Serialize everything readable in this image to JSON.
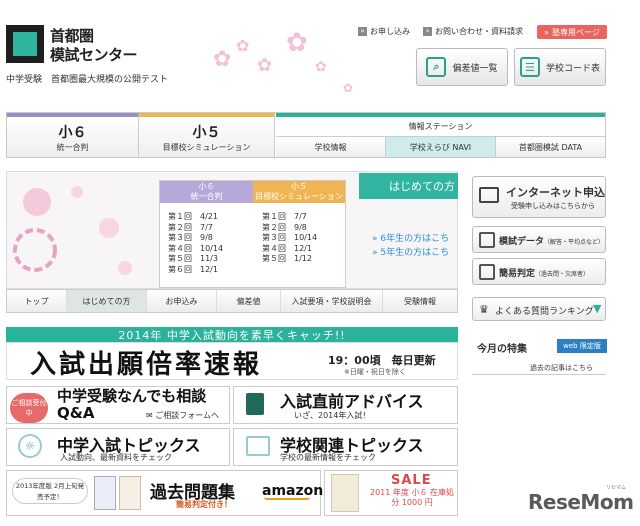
{
  "brand": {
    "name_line1": "首都圏",
    "name_line2": "模試センター",
    "tagline": "中学受験　首都圏最大規模の公開テスト"
  },
  "top_links": {
    "apply": "お申し込み",
    "contact": "お問い合わせ・資料請求",
    "juku": "塾専用ページ"
  },
  "header_buttons": {
    "hensachi": "偏差値一覧",
    "school_code": "学校コード表"
  },
  "nav": {
    "grade6": {
      "big": "小６",
      "small": "統一合判"
    },
    "grade5": {
      "big": "小５",
      "small": "目標校シミュレーション"
    },
    "station": "情報ステーション",
    "sub": [
      "学校情報",
      "学校えらび NAVI",
      "首都圏模試 DATA"
    ]
  },
  "schedule": {
    "g6_title": "小６",
    "g6_sub": "統一合判",
    "g5_title": "小５",
    "g5_sub": "目標校シミュレーション",
    "g6_rows": [
      "第１回　4/21",
      "第２回　7/7",
      "第３回　9/8",
      "第４回　10/14",
      "第５回　11/3",
      "第６回　12/1"
    ],
    "g5_rows": [
      "第１回　7/7",
      "第２回　9/8",
      "第３回　10/14",
      "第４回　12/1",
      "第５回　1/12"
    ]
  },
  "banner": {
    "hajimete": "はじめての方",
    "link6": "» 6年生の方はこち",
    "link5": "» 5年生の方はこち"
  },
  "banner_tabs": [
    "トップ",
    "はじめての方",
    "お申込み",
    "偏差値",
    "入試要項・学校説明会",
    "受験情報"
  ],
  "right": {
    "internet_title": "インターネット申込",
    "internet_sub": "受験申し込みはこちらから",
    "moshi_data": "模試データ",
    "moshi_data_sub": "（解答・平均点など）",
    "kani": "簡易判定",
    "kani_sub": "（過去問・欠席者）",
    "faq": "よくある質問ランキング",
    "tokushu": "今月の特集",
    "web_badge": "web 限定版",
    "kako": "過去の記事はこちら"
  },
  "promo": {
    "strip": "2014年 中学入試動向を素早くキャッチ!!",
    "ratio_title": "入試出願倍率速報",
    "ratio_time": "19：00頃　毎日更新",
    "ratio_note": "※日曜・祝日を除く",
    "soudan_badge": "ご相談受付中",
    "soudan_title": "中学受験なんでも相談Q&A",
    "soudan_form": "ご相談フォームへ",
    "advice_title": "入試直前アドバイス",
    "advice_sub": "いざ、2014年入試！",
    "topics_title": "中学入試トピックス",
    "topics_sub": "入試動向、最新資料をチェック",
    "school_title": "学校関連トピックス",
    "school_sub": "学校の最新情報をチェック",
    "book_badge": "2013年度版 2月上旬発売予定！",
    "kakomon_title": "過去問題集",
    "kakomon_sub": "簡易判定付き！",
    "amazon": "amazon",
    "sale": "SALE",
    "sale_sub": "2011 年度 小６ 在庫処分 1000 円"
  },
  "watermark": {
    "name": "ReseMom",
    "kana": "リセマム"
  }
}
